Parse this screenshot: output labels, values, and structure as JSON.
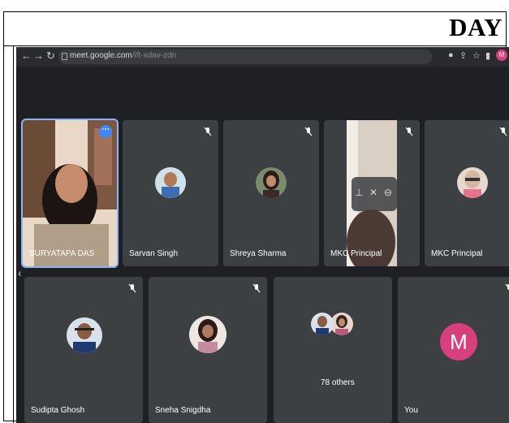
{
  "heading": "DAY",
  "browser": {
    "url_host": "meet.google.com",
    "url_path": "/ift-xdav-zdn",
    "profile_initial": "M"
  },
  "tiles": [
    {
      "name": "SURYATAPA DAS"
    },
    {
      "name": "Sarvan Singh"
    },
    {
      "name": "Shreya Sharma"
    },
    {
      "name": "MKC Principal"
    },
    {
      "name": "MKC Principal"
    },
    {
      "name": "Sudipta Ghosh"
    },
    {
      "name": "Sneha Snigdha"
    },
    {
      "name": "78 others"
    },
    {
      "name": "You",
      "initial": "M"
    }
  ],
  "colors": {
    "meet_bg": "#1f2023",
    "tile_bg": "#3c4043",
    "active_outline": "#8ab4f8",
    "you_avatar": "#d83f7d"
  }
}
